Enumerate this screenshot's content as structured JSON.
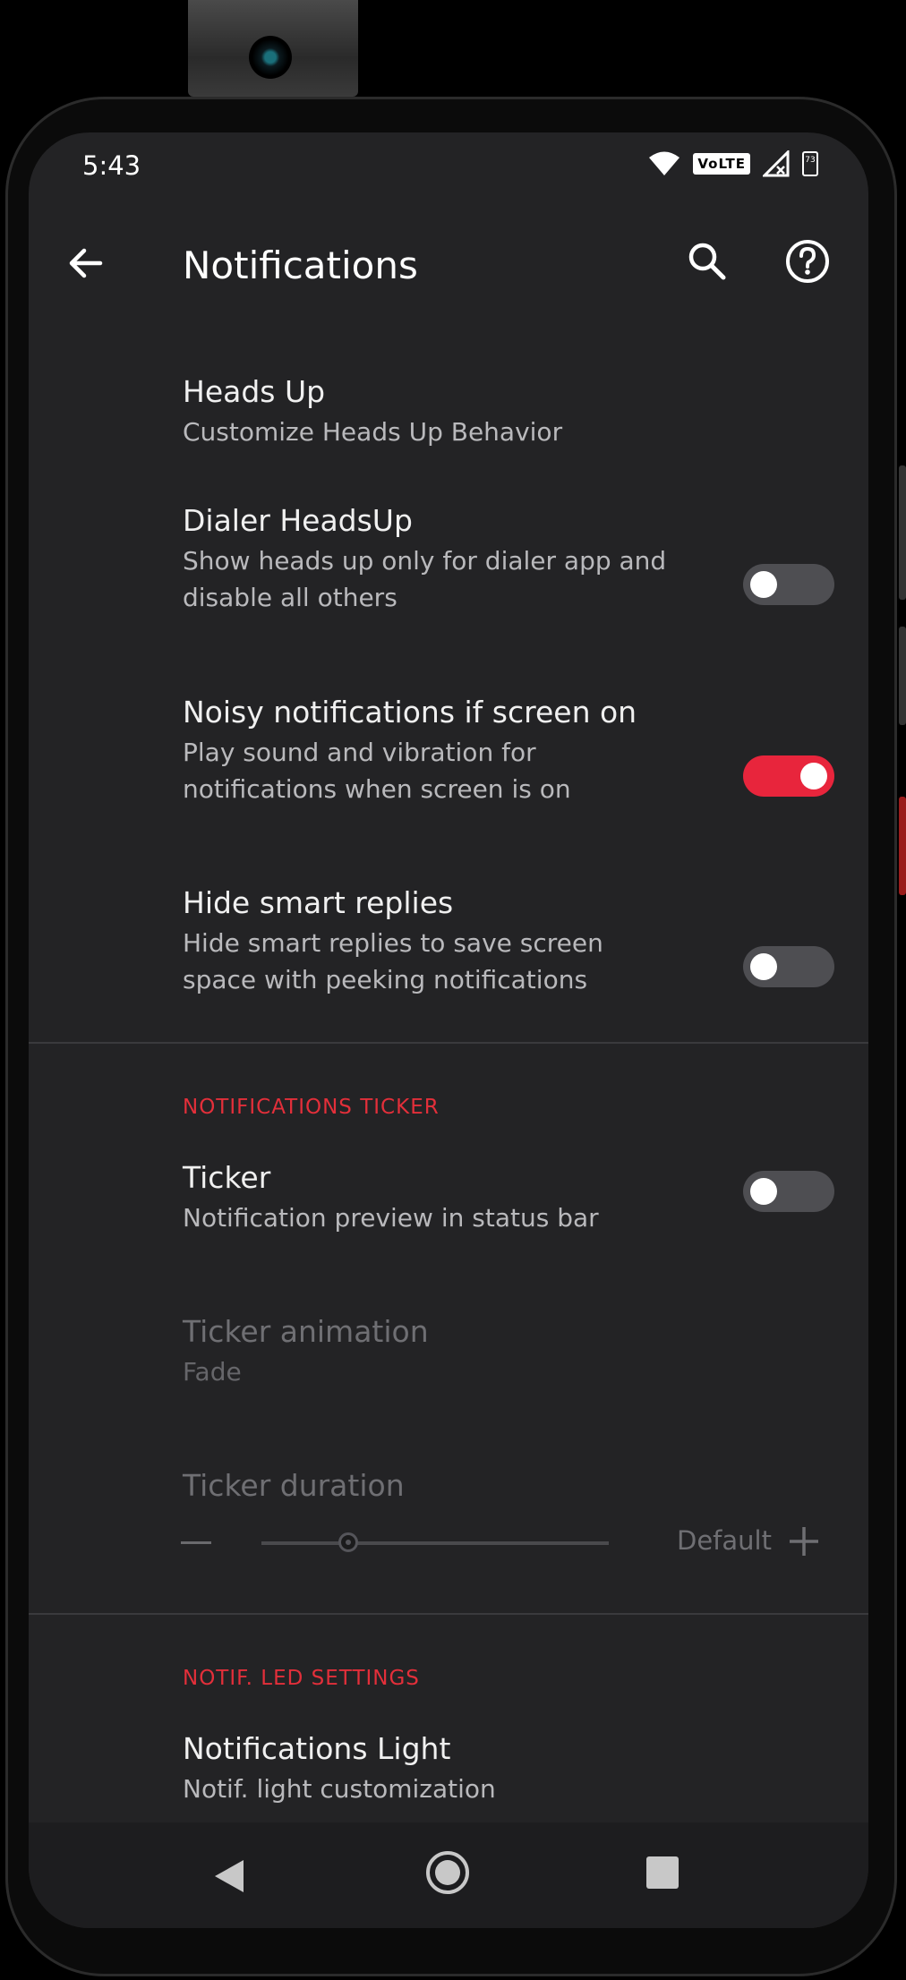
{
  "status_bar": {
    "time": "5:43",
    "network_badge": "VoLTE",
    "battery": "73"
  },
  "app_bar": {
    "title": "Notifications",
    "icons": [
      "back-arrow-icon",
      "search-icon",
      "help-icon"
    ]
  },
  "items": [
    {
      "title": "Heads Up",
      "subtitle": "Customize Heads Up Behavior"
    },
    {
      "title": "Dialer HeadsUp",
      "subtitle": "Show heads up only for dialer app and disable all others",
      "toggle": "off"
    },
    {
      "title": "Noisy notifications if screen on",
      "subtitle": "Play sound and vibration for notifications when screen is on",
      "toggle": "on"
    },
    {
      "title": "Hide smart replies",
      "subtitle": "Hide smart replies to save screen space with peeking notifications",
      "toggle": "off"
    }
  ],
  "ticker_section": {
    "header": "NOTIFICATIONS TICKER",
    "ticker": {
      "title": "Ticker",
      "subtitle": "Notification preview in status bar",
      "toggle": "off"
    },
    "ticker_animation": {
      "title": "Ticker animation",
      "subtitle": "Fade",
      "enabled": false
    },
    "ticker_duration": {
      "title": "Ticker duration",
      "value_label": "Default",
      "enabled": false,
      "slider_fraction": 0.25
    }
  },
  "led_section": {
    "header": "NOTIF. LED SETTINGS",
    "notifications_light": {
      "title": "Notifications Light",
      "subtitle": "Notif. light customization"
    }
  },
  "colors": {
    "background": "#232325",
    "accent": "#e8253c",
    "section_header": "#e32f3a"
  }
}
